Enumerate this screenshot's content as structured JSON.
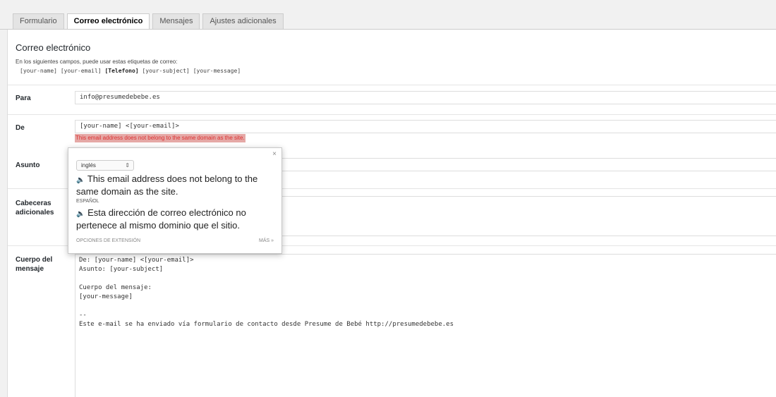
{
  "tabs": [
    {
      "label": "Formulario"
    },
    {
      "label": "Correo electrónico"
    },
    {
      "label": "Mensajes"
    },
    {
      "label": "Ajustes adicionales"
    }
  ],
  "section": {
    "title": "Correo electrónico",
    "intro": "En los siguientes campos, puede usar estas etiquetas de correo:",
    "tags": [
      "[your-name]",
      "[your-email]",
      "[Telefono]",
      "[your-subject]",
      "[your-message]"
    ]
  },
  "fields": {
    "para": {
      "label": "Para",
      "value": "info@presumedebebe.es"
    },
    "de": {
      "label": "De",
      "value": "[your-name] <[your-email]>",
      "warning": "This email address does not belong to the same domain as the site."
    },
    "asunto": {
      "label": "Asunto"
    },
    "cabeceras": {
      "label_line1": "Cabeceras",
      "label_line2": "adicionales"
    },
    "cuerpo": {
      "label_line1": "Cuerpo del",
      "label_line2": "mensaje",
      "value": "De: [your-name] <[your-email]>\nAsunto: [your-subject]\n\nCuerpo del mensaje:\n[your-message]\n\n--\nEste e-mail se ha enviado vía formulario de contacto desde Presume de Bebé http://presumedebebe.es"
    }
  },
  "translate_popup": {
    "close": "×",
    "source_language": "inglés",
    "source_text": "This email address does not belong to the same domain as the site.",
    "target_language": "ESPAÑOL",
    "target_text": "Esta dirección de correo electrónico no pertenece al mismo dominio que el sitio.",
    "options_label": "OPCIONES DE EXTENSIÓN",
    "more_label": "MÁS »"
  }
}
